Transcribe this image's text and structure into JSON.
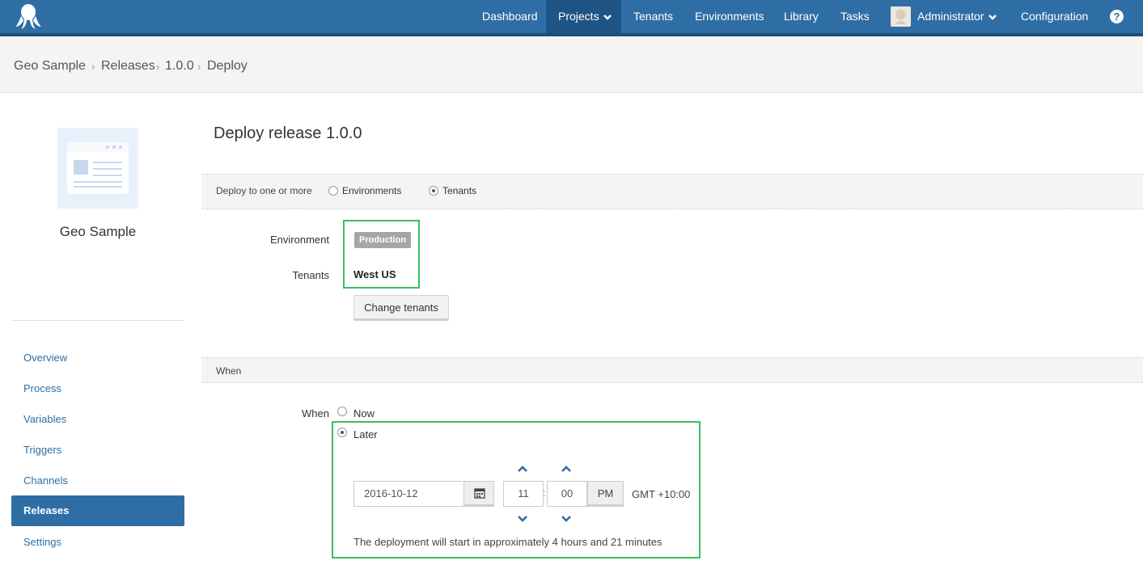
{
  "nav": {
    "items": [
      "Dashboard",
      "Projects",
      "Tenants",
      "Environments",
      "Library",
      "Tasks"
    ],
    "user": "Administrator",
    "configuration": "Configuration",
    "help": "?"
  },
  "breadcrumb": [
    "Geo Sample",
    "Releases",
    "1.0.0",
    "Deploy"
  ],
  "sidebar": {
    "project_name": "Geo Sample",
    "items": [
      "Overview",
      "Process",
      "Variables",
      "Triggers",
      "Channels",
      "Releases",
      "Settings"
    ],
    "active": "Releases"
  },
  "page": {
    "title": "Deploy release 1.0.0"
  },
  "deploy_to": {
    "label": "Deploy to one or more",
    "options": [
      "Environments",
      "Tenants"
    ],
    "selected": "Tenants"
  },
  "targets": {
    "environment_label": "Environment",
    "environment_value": "Production",
    "tenants_label": "Tenants",
    "tenants_value": "West US",
    "change_button": "Change tenants"
  },
  "when": {
    "section_title": "When",
    "label": "When",
    "options": [
      "Now",
      "Later"
    ],
    "selected": "Later",
    "date": "2016-10-12",
    "hour": "11",
    "minute": "00",
    "ampm": "PM",
    "timezone": "GMT +10:00",
    "note": "The deployment will start in approximately 4 hours and 21 minutes"
  },
  "colors": {
    "nav_bg": "#2f6ea5",
    "highlight": "#3cbf5e",
    "link": "#2f6ea5"
  }
}
